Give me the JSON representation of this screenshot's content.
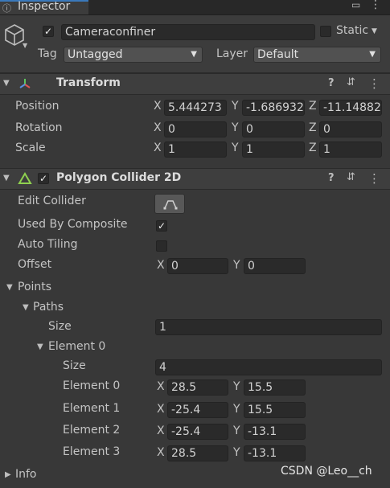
{
  "window": {
    "tab_label": "Inspector"
  },
  "gameobject": {
    "name": "Cameraconfiner",
    "static_label": "Static",
    "tag_label": "Tag",
    "tag_value": "Untagged",
    "layer_label": "Layer",
    "layer_value": "Default"
  },
  "transform": {
    "title": "Transform",
    "position_label": "Position",
    "rotation_label": "Rotation",
    "scale_label": "Scale",
    "axis_x": "X",
    "axis_y": "Y",
    "axis_z": "Z",
    "position": {
      "x": "5.444273",
      "y": "-1.686932",
      "z": "-11.14882"
    },
    "rotation": {
      "x": "0",
      "y": "0",
      "z": "0"
    },
    "scale": {
      "x": "1",
      "y": "1",
      "z": "1"
    }
  },
  "collider": {
    "title": "Polygon Collider 2D",
    "edit_collider_label": "Edit Collider",
    "used_by_composite_label": "Used By Composite",
    "auto_tiling_label": "Auto Tiling",
    "offset_label": "Offset",
    "offset": {
      "x": "0",
      "y": "0"
    },
    "points_label": "Points",
    "paths_label": "Paths",
    "size_label": "Size",
    "paths_size": "1",
    "element0_label": "Element 0",
    "element_size_label": "Size",
    "element_size": "4",
    "elements": [
      {
        "label": "Element 0",
        "x": "28.5",
        "y": "15.5"
      },
      {
        "label": "Element 1",
        "x": "-25.4",
        "y": "15.5"
      },
      {
        "label": "Element 2",
        "x": "-25.4",
        "y": "-13.1"
      },
      {
        "label": "Element 3",
        "x": "28.5",
        "y": "-13.1"
      }
    ]
  },
  "info": {
    "label": "Info"
  },
  "watermark": "CSDN @Leo__ch",
  "icons": {
    "help": "?",
    "settings": "⇵",
    "more": "⋮",
    "lock": "🔒",
    "check": "✓"
  }
}
